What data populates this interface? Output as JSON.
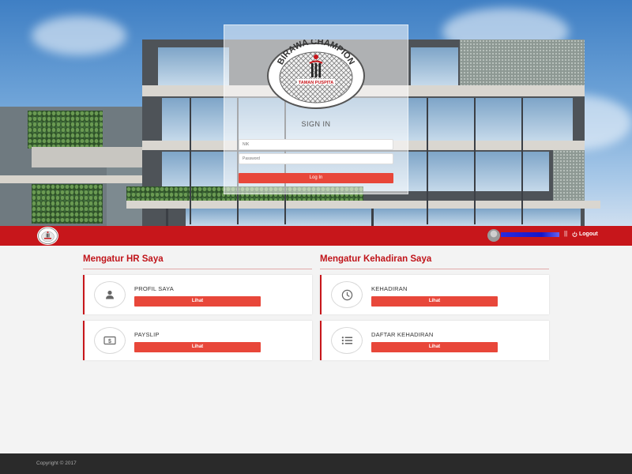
{
  "login": {
    "title": "SIGN IN",
    "nik_placeholder": "NIK",
    "password_placeholder": "Password",
    "button_label": "Log In"
  },
  "brand": {
    "name": "BIRAWA CHAMPION",
    "subtitle": "TAMAN PUSPITA",
    "accent": "#c7161b",
    "button_color": "#e8473a"
  },
  "nav": {
    "separator": "||",
    "logout_label": "Logout"
  },
  "sections": {
    "hr": {
      "title": "Mengatur HR Saya",
      "cards": [
        {
          "label": "PROFIL SAYA",
          "button": "Lihat",
          "icon": "user-icon"
        },
        {
          "label": "PAYSLIP",
          "button": "Lihat",
          "icon": "money-icon"
        }
      ]
    },
    "attendance": {
      "title": "Mengatur Kehadiran Saya",
      "cards": [
        {
          "label": "KEHADIRAN",
          "button": "Lihat",
          "icon": "clock-icon"
        },
        {
          "label": "DAFTAR KEHADIRAN",
          "button": "Lihat",
          "icon": "list-icon"
        }
      ]
    }
  },
  "footer": {
    "copyright": "Copyright © 2017"
  }
}
